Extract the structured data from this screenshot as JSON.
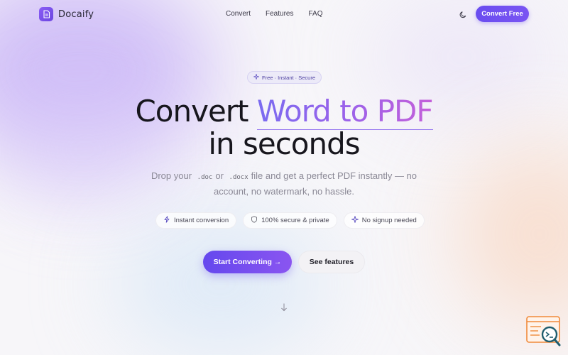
{
  "brand": {
    "name": "Docaify"
  },
  "nav": {
    "links": [
      "Convert",
      "Features",
      "FAQ"
    ],
    "cta_label": "Convert Free"
  },
  "hero": {
    "badge": "Free · Instant · Secure",
    "headline_prefix": "Convert",
    "headline_highlight": "Word to PDF",
    "headline_line2": "in seconds",
    "sub_part1": "Drop your",
    "code_doc": ".doc",
    "sub_or": "or",
    "code_docx": ".docx",
    "sub_part2": "file and get a perfect PDF instantly — no",
    "sub_line2": "account, no watermark, no hassle."
  },
  "features": [
    {
      "icon": "lightning-icon",
      "label": "Instant conversion"
    },
    {
      "icon": "shield-icon",
      "label": "100% secure & private"
    },
    {
      "icon": "sparkle-icon",
      "label": "No signup needed"
    }
  ],
  "actions": {
    "primary_label": "Start Converting →",
    "secondary_label": "See features"
  },
  "colors": {
    "accent": "#6a4df0",
    "gradient_end": "#c45fd9",
    "background": "#f7f6f9"
  }
}
